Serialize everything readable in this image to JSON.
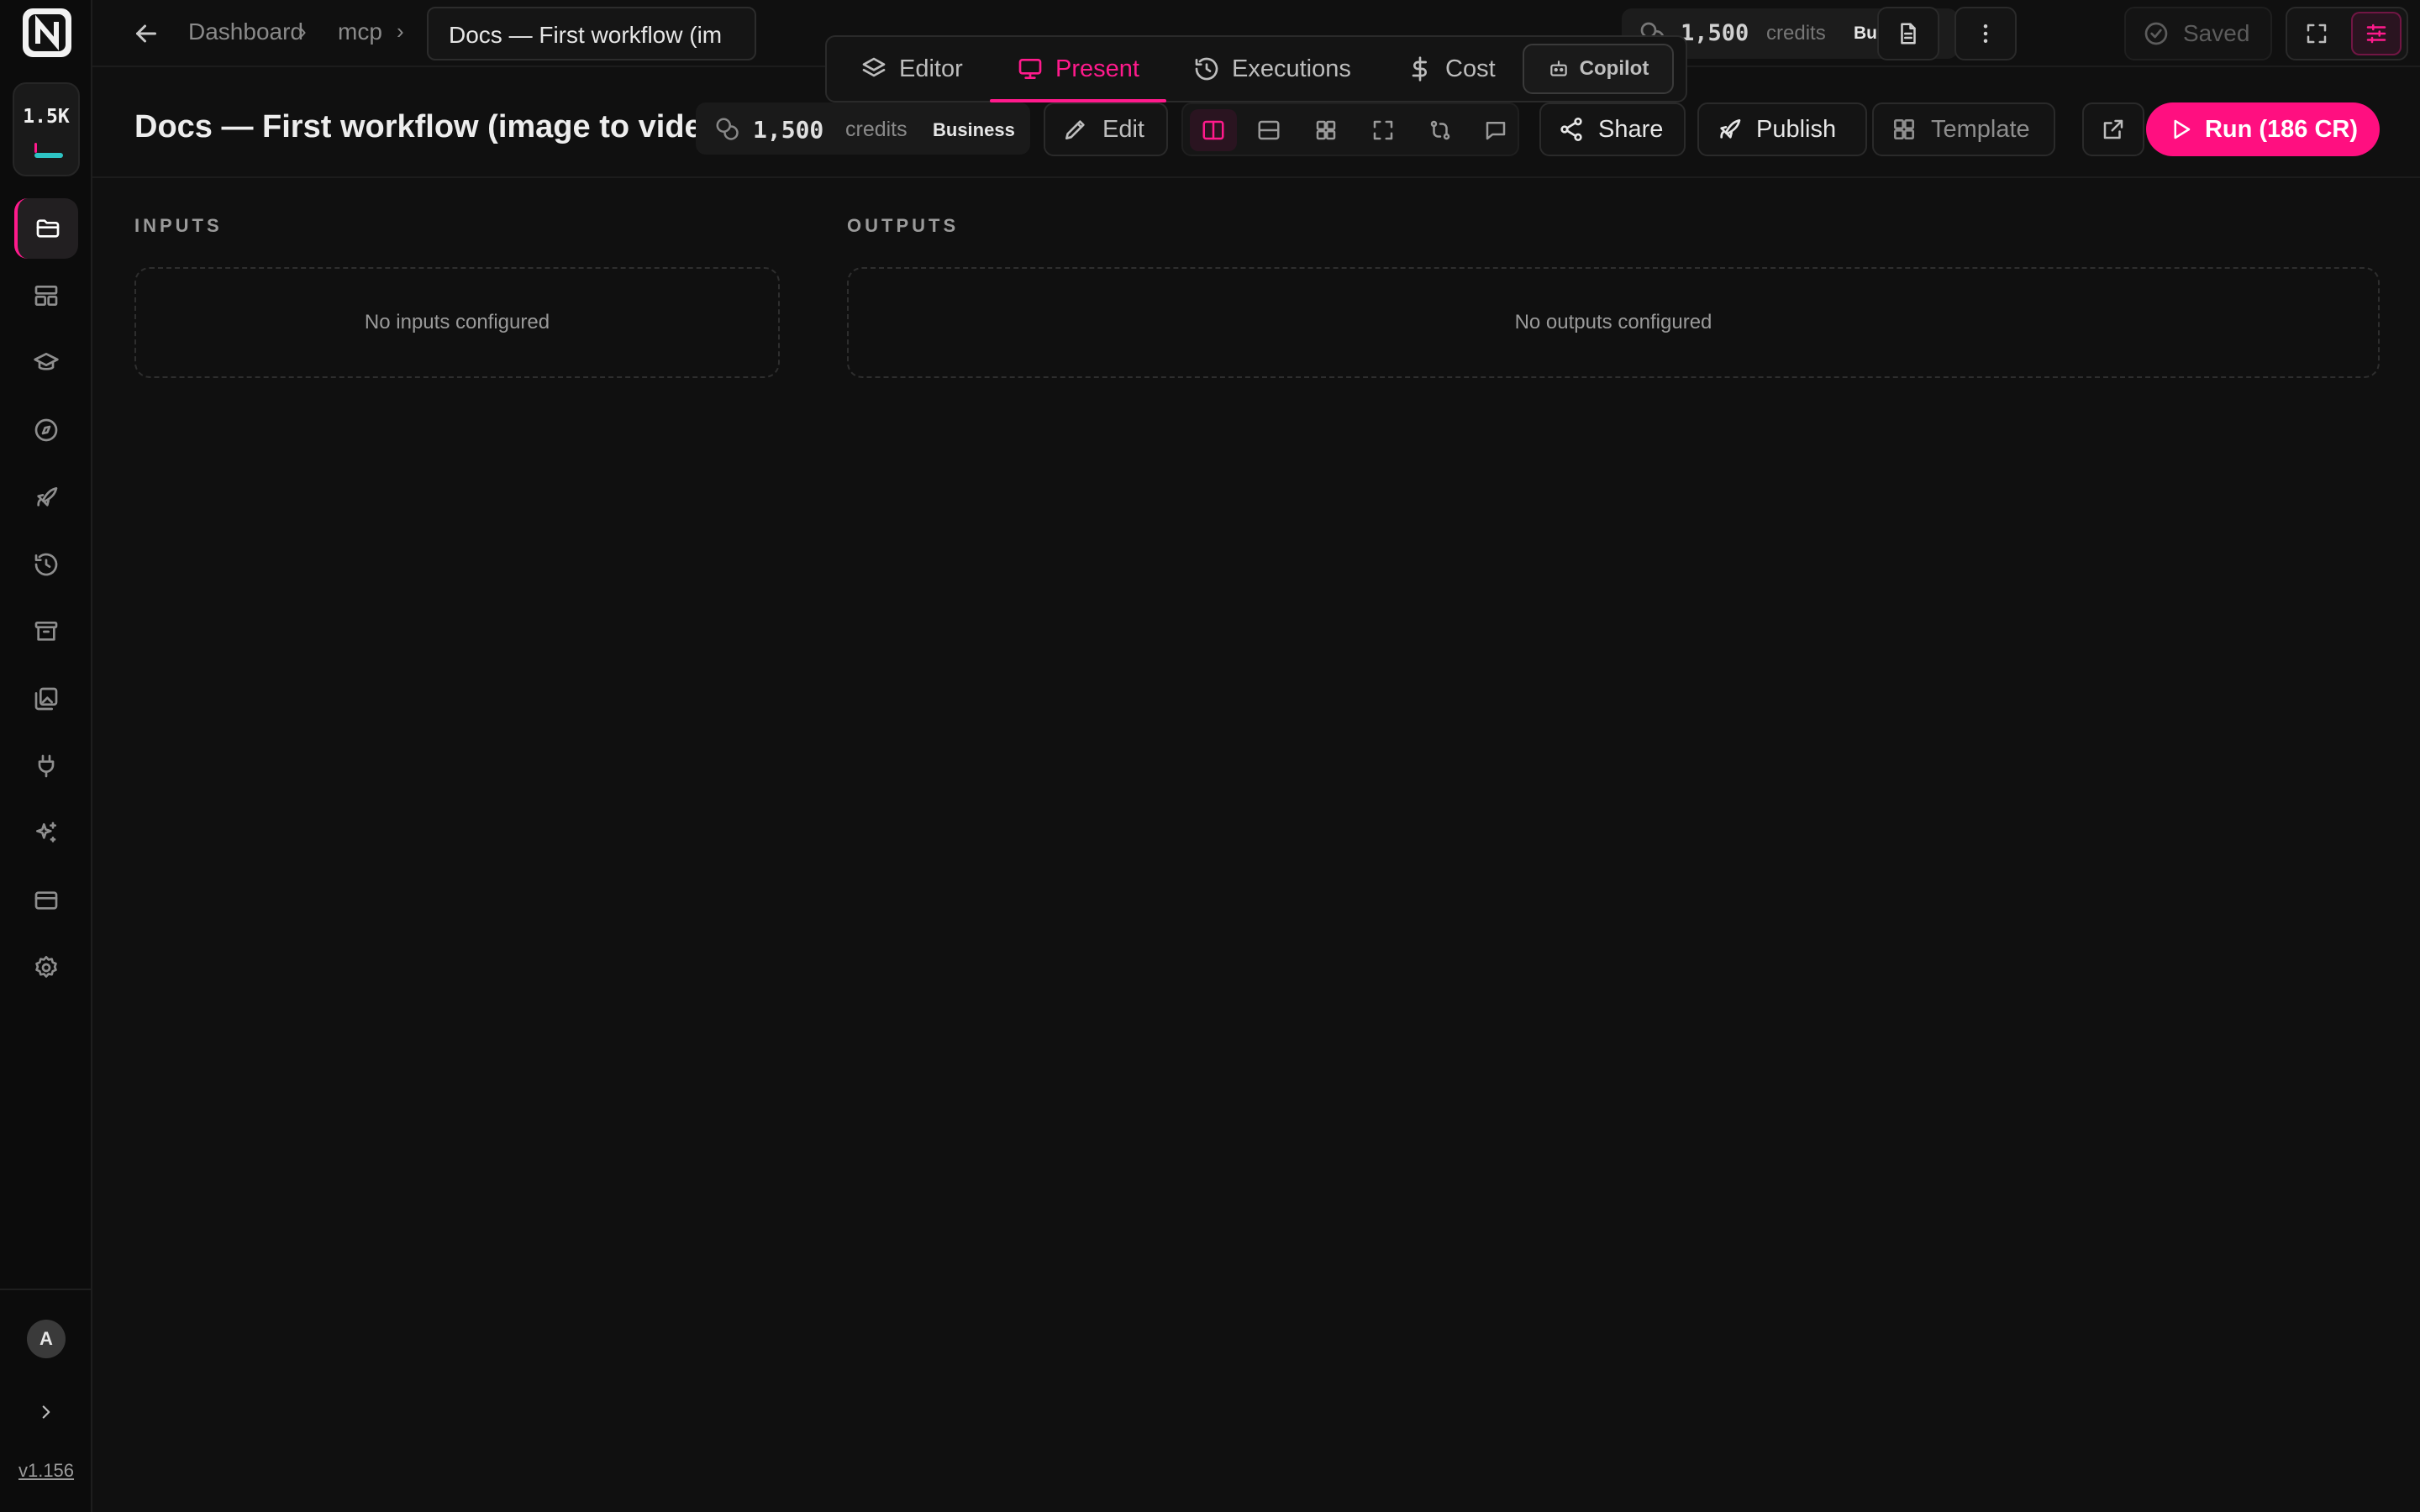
{
  "app": {
    "version": "v1.156"
  },
  "sidebar": {
    "credits_short": "1.5K",
    "avatar_initial": "A",
    "items": [
      {
        "name": "folder-icon",
        "active": true
      },
      {
        "name": "layout-icon",
        "active": false
      },
      {
        "name": "graduation-cap-icon",
        "active": false
      },
      {
        "name": "compass-icon",
        "active": false
      },
      {
        "name": "rocket-icon",
        "active": false
      },
      {
        "name": "history-icon",
        "active": false
      },
      {
        "name": "archive-icon",
        "active": false
      },
      {
        "name": "images-icon",
        "active": false
      },
      {
        "name": "plug-icon",
        "active": false
      },
      {
        "name": "sparkles-icon",
        "active": false
      },
      {
        "name": "credit-card-icon",
        "active": false
      },
      {
        "name": "gear-icon",
        "active": false
      }
    ]
  },
  "topbar": {
    "breadcrumb": [
      "Dashboard",
      "mcp"
    ],
    "current": "Docs — First workflow (im",
    "credits": {
      "amount": "1,500",
      "label": "credits",
      "tier": "Business"
    },
    "saved_label": "Saved"
  },
  "tabs": [
    {
      "label": "Editor",
      "icon": "layers-icon",
      "active": false
    },
    {
      "label": "Present",
      "icon": "monitor-icon",
      "active": true
    },
    {
      "label": "Executions",
      "icon": "history-icon",
      "active": false
    },
    {
      "label": "Cost",
      "icon": "dollar-icon",
      "active": false
    }
  ],
  "copilot_label": "Copilot",
  "header": {
    "title": "Docs — First workflow (image to video)",
    "credits": {
      "amount": "1,500",
      "label": "credits",
      "tier": "Business"
    },
    "edit_label": "Edit",
    "share_label": "Share",
    "publish_label": "Publish",
    "template_label": "Template",
    "run_label": "Run (186 CR)"
  },
  "content": {
    "inputs_label": "INPUTS",
    "inputs_empty": "No inputs configured",
    "outputs_label": "OUTPUTS",
    "outputs_empty": "No outputs configured"
  },
  "colors": {
    "accent": "#ff0f80",
    "background": "#101010",
    "teal": "#2ec4c4"
  }
}
